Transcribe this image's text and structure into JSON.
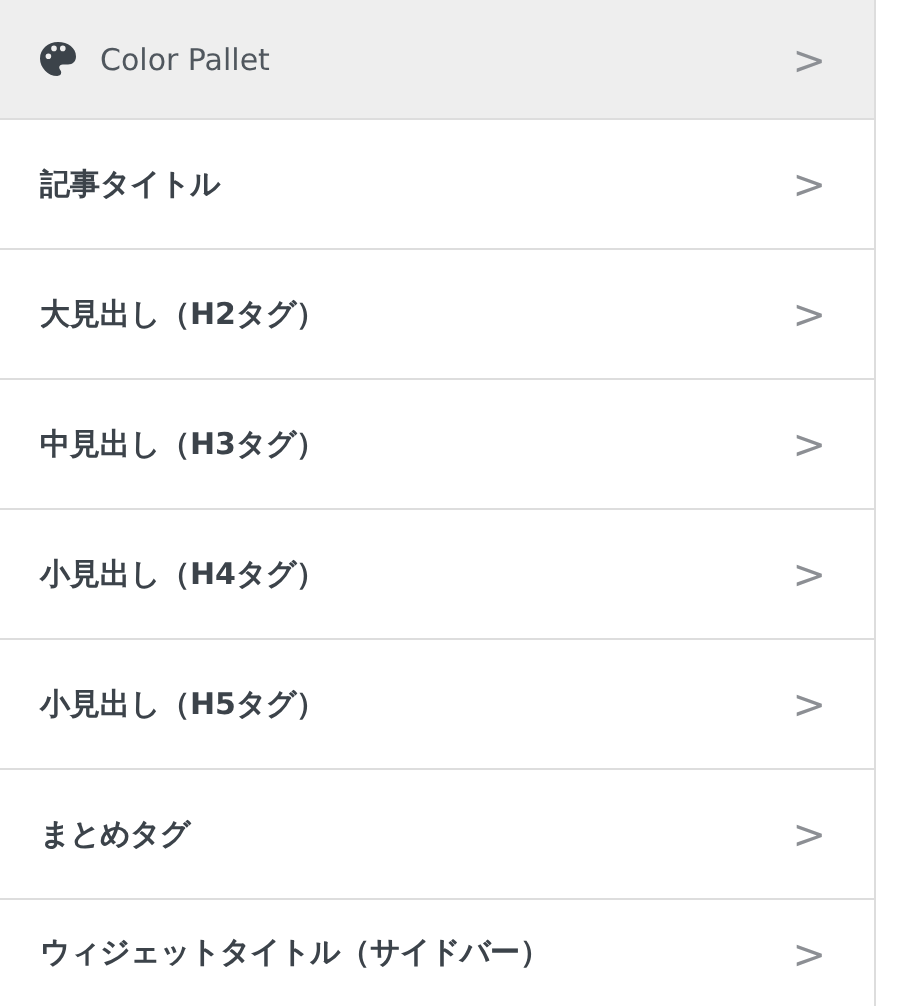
{
  "header": {
    "label": "Color Pallet",
    "chevron": ">"
  },
  "items": [
    {
      "label": "記事タイトル",
      "chevron": ">"
    },
    {
      "label": "大見出し（H2タグ）",
      "chevron": ">"
    },
    {
      "label": "中見出し（H3タグ）",
      "chevron": ">"
    },
    {
      "label": "小見出し（H4タグ）",
      "chevron": ">"
    },
    {
      "label": "小見出し（H5タグ）",
      "chevron": ">"
    },
    {
      "label": "まとめタグ",
      "chevron": ">"
    },
    {
      "label": "ウィジェットタイトル（サイドバー）",
      "chevron": ">"
    }
  ]
}
